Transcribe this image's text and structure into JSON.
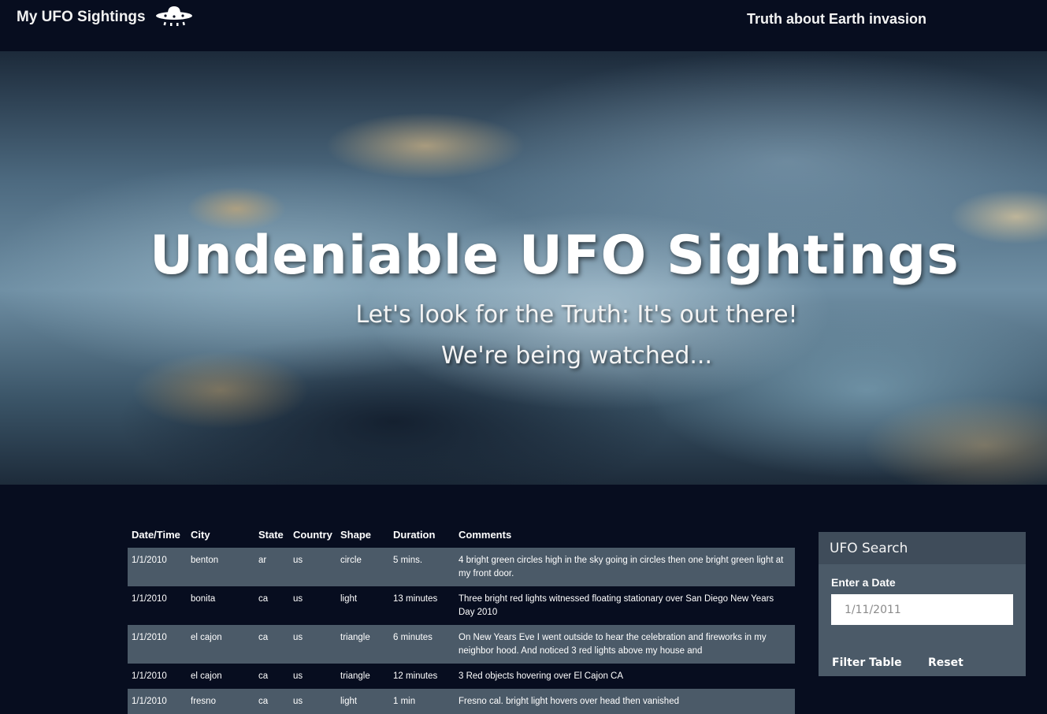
{
  "navbar": {
    "brand": "My UFO Sightings",
    "brand_icon": "ufo-icon",
    "link": "Truth about Earth invasion"
  },
  "hero": {
    "title": "Undeniable UFO Sightings",
    "subtitle": "Let's look for the Truth: It's out there!",
    "tagline": "We're being watched..."
  },
  "table": {
    "headers": [
      "Date/Time",
      "City",
      "State",
      "Country",
      "Shape",
      "Duration",
      "Comments"
    ],
    "rows": [
      [
        "1/1/2010",
        "benton",
        "ar",
        "us",
        "circle",
        "5 mins.",
        "4 bright green circles high in the sky going in circles then one bright green light at my front door."
      ],
      [
        "1/1/2010",
        "bonita",
        "ca",
        "us",
        "light",
        "13 minutes",
        "Three bright red lights witnessed floating stationary over San Diego New Years Day 2010"
      ],
      [
        "1/1/2010",
        "el cajon",
        "ca",
        "us",
        "triangle",
        "6 minutes",
        "On New Years Eve I went outside to hear the celebration and fireworks in my neighbor hood. And noticed 3 red lights above my house and"
      ],
      [
        "1/1/2010",
        "el cajon",
        "ca",
        "us",
        "triangle",
        "12 minutes",
        "3 Red objects hovering over El Cajon CA"
      ],
      [
        "1/1/2010",
        "fresno",
        "ca",
        "us",
        "light",
        "1 min",
        "Fresno cal. bright light hovers over head then vanished"
      ]
    ]
  },
  "search": {
    "title": "UFO Search",
    "date_label": "Enter a Date",
    "date_placeholder": "1/11/2011",
    "filter_label": "Filter Table",
    "reset_label": "Reset"
  },
  "colors": {
    "background": "#070d1f",
    "row_stripe": "#4b5a68",
    "panel": "#4b5a68",
    "panel_header": "#3f4c5a"
  }
}
